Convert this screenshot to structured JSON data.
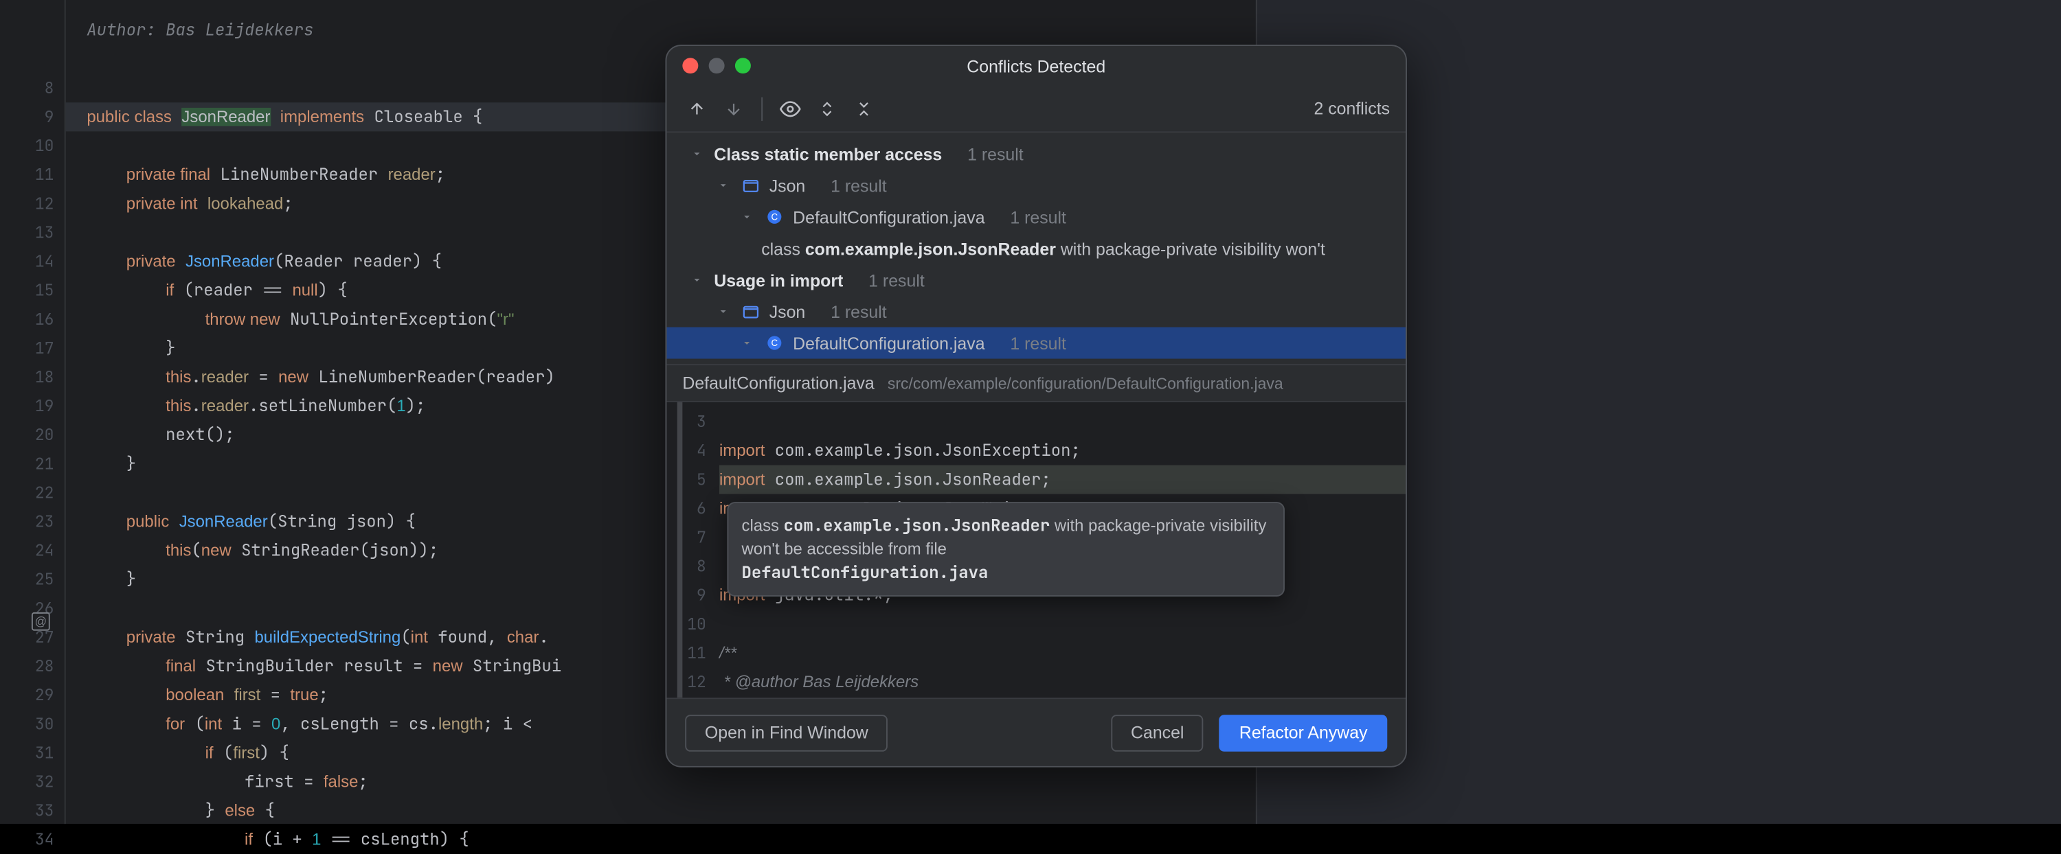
{
  "editor": {
    "author_comment": "Author: Bas Leijdekkers",
    "at_marker": "@",
    "line_start": 8,
    "lines": [
      {
        "n": 8,
        "html": ""
      },
      {
        "n": 9,
        "html": "<span class='kw'>public class</span> <span class='cls-ref'>JsonReader</span> <span class='kw'>implements</span> Closeable {",
        "band": true
      },
      {
        "n": 10,
        "html": ""
      },
      {
        "n": 11,
        "html": "    <span class='kw'>private final</span> LineNumberReader <span class='def'>reader</span>;"
      },
      {
        "n": 12,
        "html": "    <span class='kw'>private int</span> <span class='def'>lookahead</span>;"
      },
      {
        "n": 13,
        "html": ""
      },
      {
        "n": 14,
        "html": "    <span class='kw'>private</span> <span class='fn'>JsonReader</span>(Reader reader) {"
      },
      {
        "n": 15,
        "html": "        <span class='kw'>if</span> (reader == <span class='kw'>null</span>) {"
      },
      {
        "n": 16,
        "html": "            <span class='kw'>throw new</span> NullPointerException(<span class='str'>\"r\"</span>"
      },
      {
        "n": 17,
        "html": "        }"
      },
      {
        "n": 18,
        "html": "        <span class='kw'>this</span>.<span class='def'>reader</span> = <span class='kw'>new</span> LineNumberReader(reader)"
      },
      {
        "n": 19,
        "html": "        <span class='kw'>this</span>.<span class='def'>reader</span>.setLineNumber(<span class='num'>1</span>);"
      },
      {
        "n": 20,
        "html": "        next();"
      },
      {
        "n": 21,
        "html": "    }"
      },
      {
        "n": 22,
        "html": ""
      },
      {
        "n": 23,
        "html": "    <span class='kw'>public</span> <span class='fn'>JsonReader</span>(String json) {"
      },
      {
        "n": 24,
        "html": "        <span class='kw'>this</span>(<span class='kw'>new</span> StringReader(json));"
      },
      {
        "n": 25,
        "html": "    }"
      },
      {
        "n": 26,
        "html": ""
      },
      {
        "n": 27,
        "html": "    <span class='kw'>private</span> String <span class='fn'>buildExpectedString</span>(<span class='kw'>int</span> found, <span class='kw'>char</span>."
      },
      {
        "n": 28,
        "html": "        <span class='kw'>final</span> StringBuilder result = <span class='kw'>new</span> StringBui"
      },
      {
        "n": 29,
        "html": "        <span class='kw'>boolean</span> <span class='def'>first</span> = <span class='kw'>true</span>;"
      },
      {
        "n": 30,
        "html": "        <span class='kw'>for</span> (<span class='kw'>int</span> i = <span class='num'>0</span>, csLength = cs.<span class='def'>length</span>; i &lt;"
      },
      {
        "n": 31,
        "html": "            <span class='kw'>if</span> (<span class='def'>first</span>) {"
      },
      {
        "n": 32,
        "html": "                first = <span class='kw'>false</span>;"
      },
      {
        "n": 33,
        "html": "            } <span class='kw'>else</span> {"
      },
      {
        "n": 34,
        "html": "                <span class='kw'>if</span> (i + <span class='num'>1</span> == csLength) {"
      }
    ]
  },
  "dialog": {
    "title": "Conflicts Detected",
    "count": "2 conflicts",
    "groups": [
      {
        "label": "Class static member access",
        "count": "1 result",
        "module": {
          "name": "Json",
          "count": "1 result"
        },
        "file": {
          "name": "DefaultConfiguration.java",
          "count": "1 result"
        },
        "usage": {
          "pre": "class ",
          "bold": "com.example.json.JsonReader",
          "post": " with package-private visibility won't"
        }
      },
      {
        "label": "Usage in import",
        "count": "1 result",
        "module": {
          "name": "Json",
          "count": "1 result"
        },
        "file": {
          "name": "DefaultConfiguration.java",
          "count": "1 result"
        }
      }
    ],
    "preview": {
      "file": "DefaultConfiguration.java",
      "path": "src/com/example/configuration/DefaultConfiguration.java",
      "line_start": 3,
      "lines": [
        {
          "n": 3,
          "html": ""
        },
        {
          "n": 4,
          "html": "<span class='kw'>import</span> com.example.json.JsonException;"
        },
        {
          "n": 5,
          "html": "<span class='kw'>import</span> com.example.json.JsonReader;",
          "hl": true
        },
        {
          "n": 6,
          "html": "<span class='kw'>import</span> com example json JsonWriter;"
        },
        {
          "n": 7,
          "html": ""
        },
        {
          "n": 8,
          "html": ""
        },
        {
          "n": 9,
          "html": "<span class='kw'>import</span> java.util.*;"
        },
        {
          "n": 10,
          "html": ""
        },
        {
          "n": 11,
          "html": "<span class='comment'>/**</span>"
        },
        {
          "n": 12,
          "html": "<span class='comment'> * @author Bas Leijdekkers</span>"
        }
      ]
    },
    "tooltip": {
      "pre": "class ",
      "qual": "com.example.json.JsonReader",
      "mid": " with package-private visibility won't be accessible from file ",
      "file": "DefaultConfiguration.java"
    },
    "buttons": {
      "open": "Open in Find Window",
      "cancel": "Cancel",
      "primary": "Refactor Anyway"
    }
  }
}
